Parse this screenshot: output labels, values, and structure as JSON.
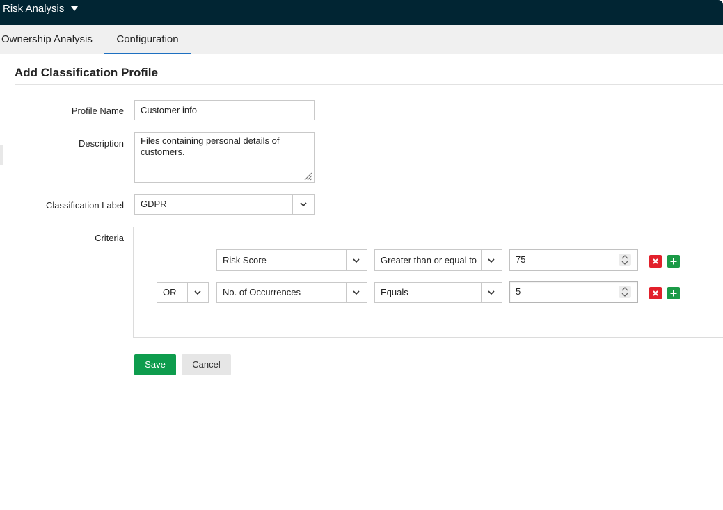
{
  "header": {
    "app_title": "Risk Analysis"
  },
  "tabs": [
    {
      "label": "Ownership Analysis",
      "active": false
    },
    {
      "label": "Configuration",
      "active": true
    }
  ],
  "form": {
    "heading": "Add Classification Profile",
    "profile_name_label": "Profile Name",
    "profile_name_value": "Customer info",
    "description_label": "Description",
    "description_value": "Files containing personal details of customers.",
    "classification_label": "Classification Label",
    "classification_value": "GDPR",
    "criteria_label": "Criteria"
  },
  "criteria": [
    {
      "operator": "",
      "field": "Risk Score",
      "condition": "Greater than or equal to",
      "value": "75"
    },
    {
      "operator": "OR",
      "field": "No. of Occurrences",
      "condition": "Equals",
      "value": "5"
    }
  ],
  "buttons": {
    "save": "Save",
    "cancel": "Cancel"
  },
  "colors": {
    "topbar": "#012533",
    "tab_underline": "#1e70c1",
    "save": "#0e9c4d",
    "delete": "#e2202b",
    "add": "#1b9a47"
  },
  "icons": {
    "app_menu": "caret-down-icon",
    "select": "chevron-down-icon",
    "spinner": "spinner-icon",
    "delete": "close-icon",
    "add": "plus-icon",
    "resize": "resize-handle-icon"
  }
}
